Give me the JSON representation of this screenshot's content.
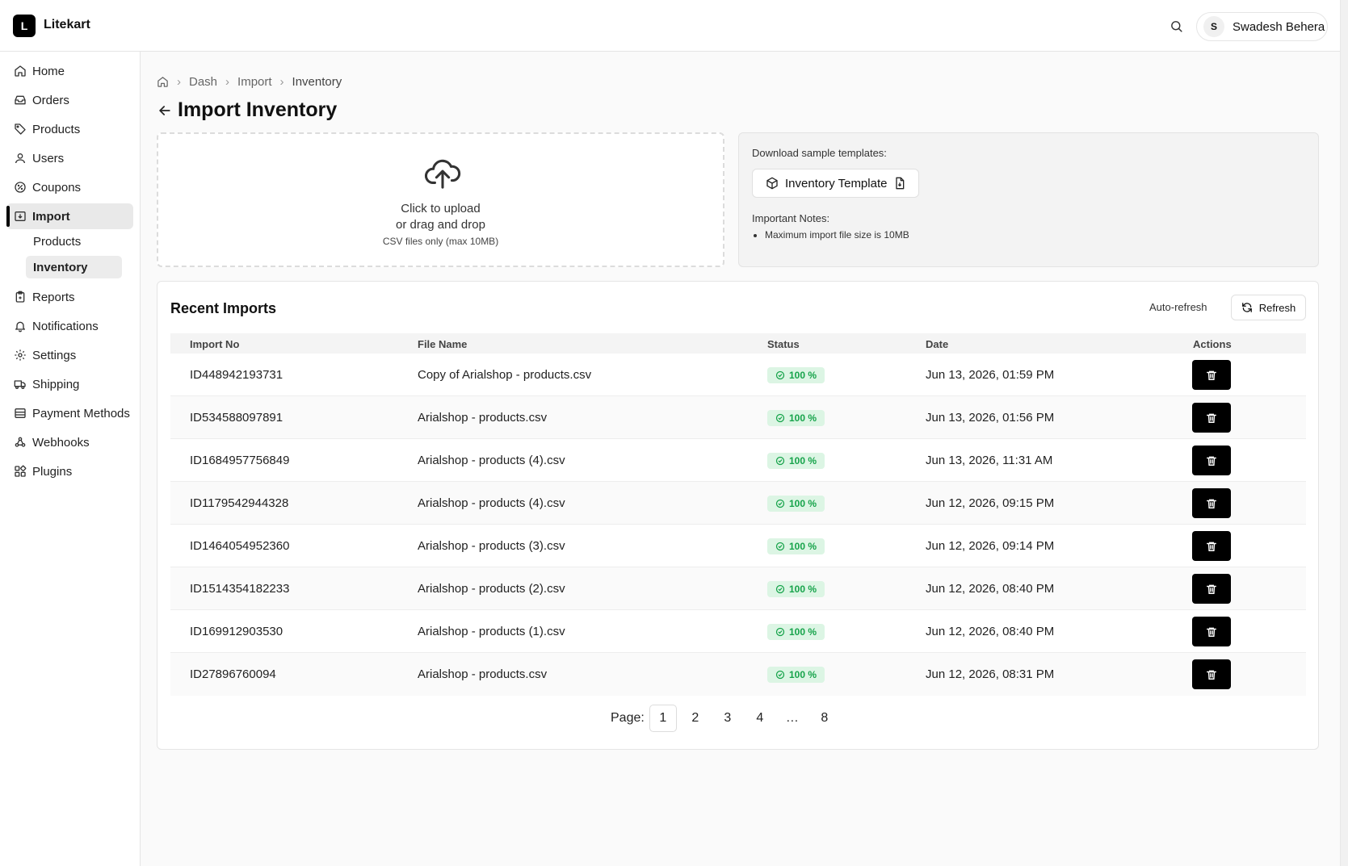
{
  "app": {
    "logo_letter": "L",
    "brand": "Litekart"
  },
  "header": {
    "user_initial": "S",
    "user_name": "Swadesh Behera"
  },
  "sidebar": {
    "items": [
      {
        "label": "Home",
        "icon": "home-icon"
      },
      {
        "label": "Orders",
        "icon": "inbox-icon"
      },
      {
        "label": "Products",
        "icon": "tag-icon"
      },
      {
        "label": "Users",
        "icon": "user-icon"
      },
      {
        "label": "Coupons",
        "icon": "coupon-icon"
      },
      {
        "label": "Import",
        "icon": "import-icon"
      },
      {
        "label": "Reports",
        "icon": "clipboard-icon"
      },
      {
        "label": "Notifications",
        "icon": "bell-icon"
      },
      {
        "label": "Settings",
        "icon": "gear-icon"
      },
      {
        "label": "Shipping",
        "icon": "truck-icon"
      },
      {
        "label": "Payment Methods",
        "icon": "database-icon"
      },
      {
        "label": "Webhooks",
        "icon": "webhook-icon"
      },
      {
        "label": "Plugins",
        "icon": "plugin-icon"
      }
    ],
    "import_sub": [
      "Products",
      "Inventory"
    ]
  },
  "breadcrumb": [
    "Dash",
    "Import",
    "Inventory"
  ],
  "page": {
    "title": "Import Inventory"
  },
  "upload": {
    "line1": "Click to upload",
    "line2": "or drag and drop",
    "hint": "CSV files only (max 10MB)"
  },
  "templates": {
    "label": "Download sample templates:",
    "button": "Inventory Template",
    "notes_label": "Important Notes:",
    "notes": [
      "Maximum import file size is 10MB"
    ]
  },
  "recent": {
    "title": "Recent Imports",
    "auto_refresh": "Auto-refresh",
    "refresh": "Refresh",
    "columns": [
      "Import No",
      "File Name",
      "Status",
      "Date",
      "Actions"
    ],
    "rows": [
      {
        "id": "ID448942193731",
        "file": "Copy of Arialshop - products.csv",
        "status": "100 %",
        "date": "Jun 13, 2026, 01:59 PM"
      },
      {
        "id": "ID534588097891",
        "file": "Arialshop - products.csv",
        "status": "100 %",
        "date": "Jun 13, 2026, 01:56 PM"
      },
      {
        "id": "ID1684957756849",
        "file": "Arialshop - products (4).csv",
        "status": "100 %",
        "date": "Jun 13, 2026, 11:31 AM"
      },
      {
        "id": "ID1179542944328",
        "file": "Arialshop - products (4).csv",
        "status": "100 %",
        "date": "Jun 12, 2026, 09:15 PM"
      },
      {
        "id": "ID1464054952360",
        "file": "Arialshop - products (3).csv",
        "status": "100 %",
        "date": "Jun 12, 2026, 09:14 PM"
      },
      {
        "id": "ID1514354182233",
        "file": "Arialshop - products (2).csv",
        "status": "100 %",
        "date": "Jun 12, 2026, 08:40 PM"
      },
      {
        "id": "ID169912903530",
        "file": "Arialshop - products (1).csv",
        "status": "100 %",
        "date": "Jun 12, 2026, 08:40 PM"
      },
      {
        "id": "ID27896760094",
        "file": "Arialshop - products.csv",
        "status": "100 %",
        "date": "Jun 12, 2026, 08:31 PM"
      }
    ]
  },
  "pagination": {
    "label": "Page:",
    "pages": [
      "1",
      "2",
      "3",
      "4",
      "…",
      "8"
    ],
    "current": "1"
  },
  "colors": {
    "accent": "#000000",
    "success_bg": "#dcf5e4",
    "success_text": "#16a34a"
  }
}
